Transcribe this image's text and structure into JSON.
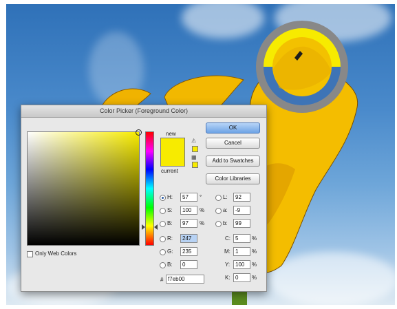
{
  "dialog": {
    "title": "Color Picker (Foreground Color)",
    "new_label": "new",
    "current_label": "current",
    "only_web_label": "Only Web Colors",
    "buttons": {
      "ok": "OK",
      "cancel": "Cancel",
      "add_swatches": "Add to Swatches",
      "libraries": "Color Libraries"
    },
    "fields": {
      "H": {
        "label": "H:",
        "value": "57",
        "unit": "°"
      },
      "S": {
        "label": "S:",
        "value": "100",
        "unit": "%"
      },
      "Bri": {
        "label": "B:",
        "value": "97",
        "unit": "%"
      },
      "R": {
        "label": "R:",
        "value": "247"
      },
      "G": {
        "label": "G:",
        "value": "235"
      },
      "B": {
        "label": "B:",
        "value": "0"
      },
      "L": {
        "label": "L:",
        "value": "92"
      },
      "a": {
        "label": "a:",
        "value": "-9"
      },
      "b": {
        "label": "b:",
        "value": "99"
      },
      "C": {
        "label": "C:",
        "value": "5",
        "unit": "%"
      },
      "M": {
        "label": "M:",
        "value": "1",
        "unit": "%"
      },
      "Y": {
        "label": "Y:",
        "value": "100",
        "unit": "%"
      },
      "K": {
        "label": "K:",
        "value": "0",
        "unit": "%"
      },
      "hex_label": "#",
      "hex": "f7eb00"
    },
    "colors": {
      "selected": "#f7eb00",
      "accent": "#2a5ca5"
    }
  }
}
